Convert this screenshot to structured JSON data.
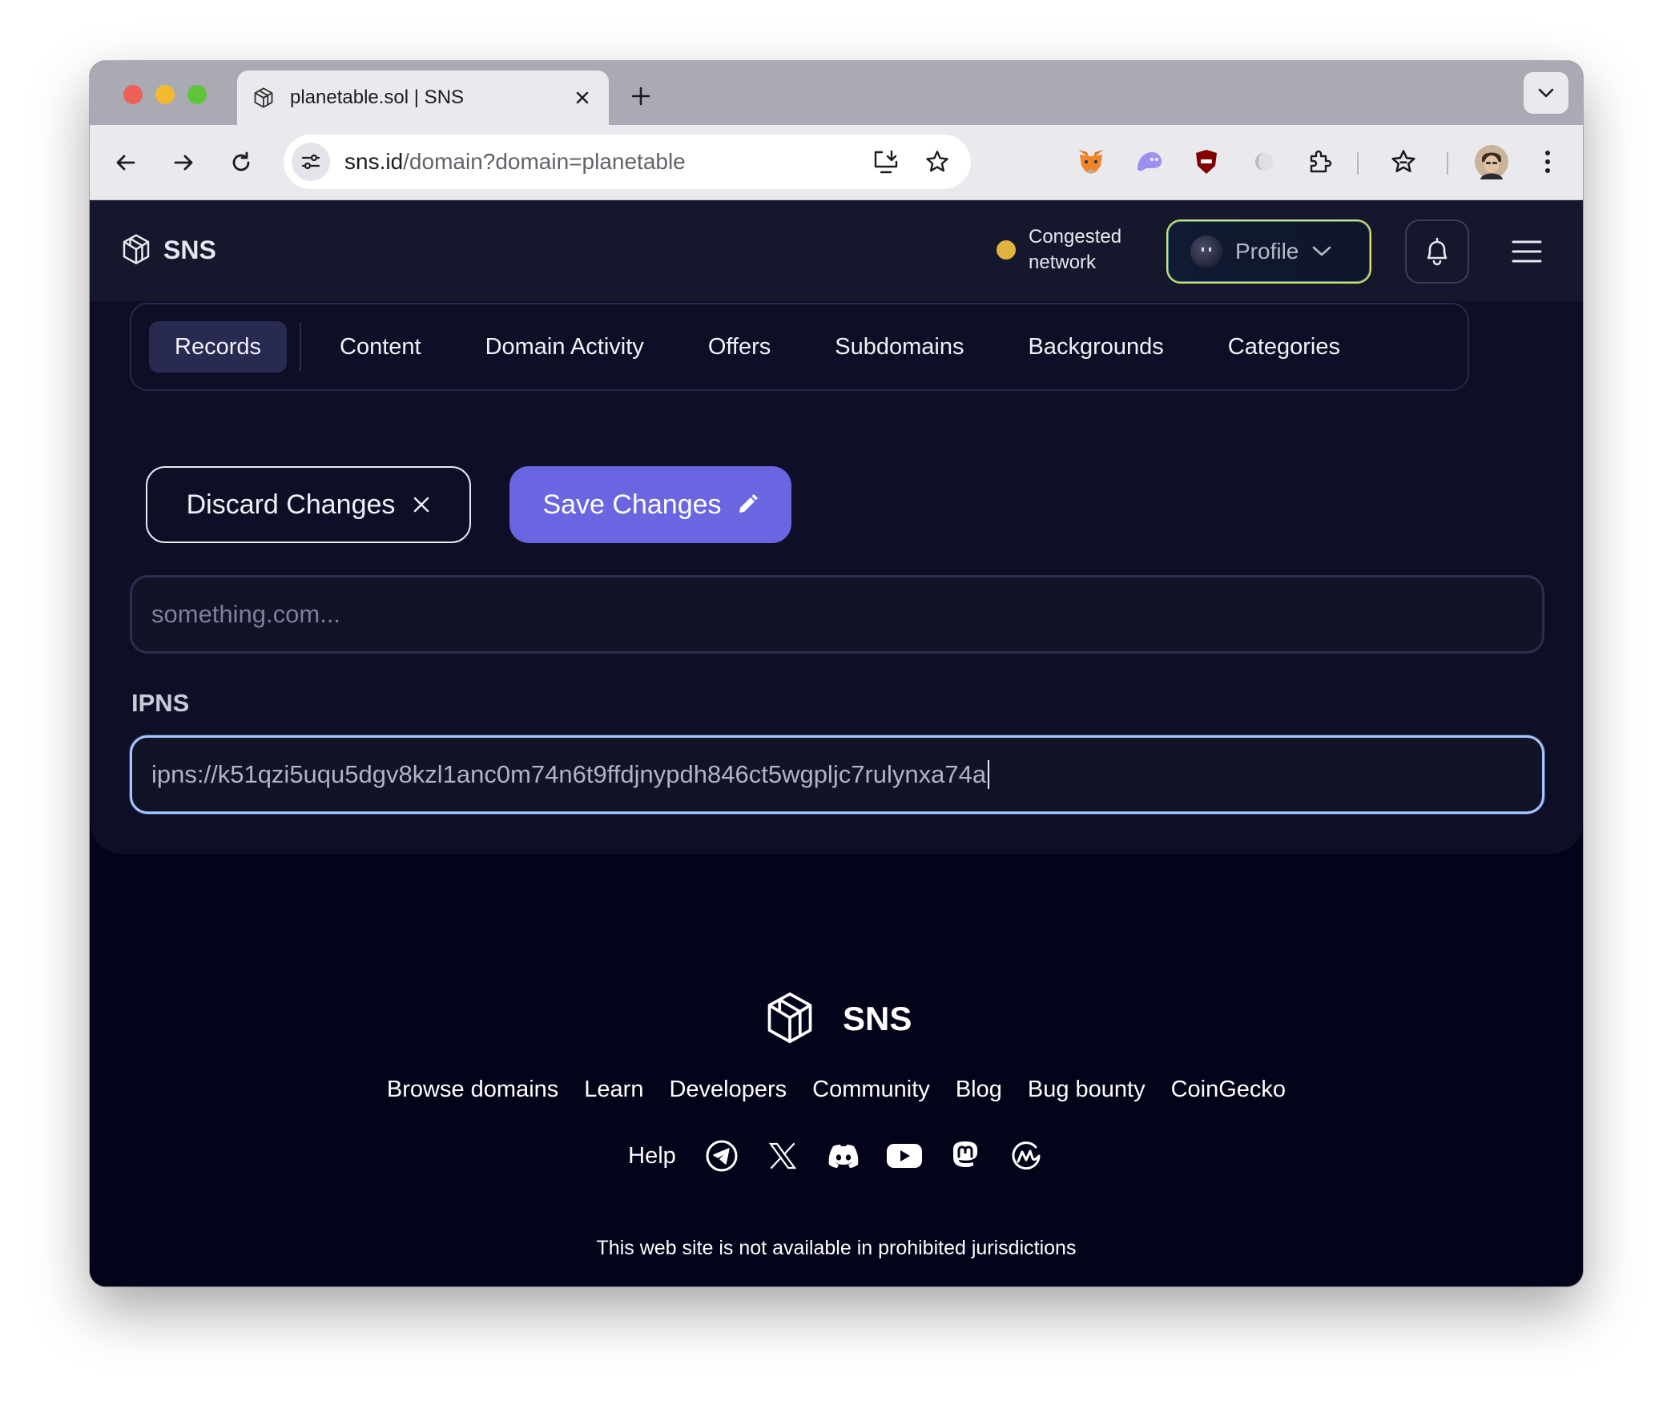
{
  "browser": {
    "tab_title": "planetable.sol | SNS",
    "url_host": "sns.id",
    "url_path": "/domain?domain=planetable"
  },
  "header": {
    "brand": "SNS",
    "status_text": "Congested network",
    "status_color": "#e1b33e",
    "profile_label": "Profile"
  },
  "tabs": [
    {
      "label": "Records",
      "active": true
    },
    {
      "label": "Content"
    },
    {
      "label": "Domain Activity"
    },
    {
      "label": "Offers"
    },
    {
      "label": "Subdomains"
    },
    {
      "label": "Backgrounds"
    },
    {
      "label": "Categories"
    }
  ],
  "actions": {
    "discard_label": "Discard Changes",
    "save_label": "Save Changes",
    "save_color": "#6a65e0"
  },
  "form": {
    "url_placeholder": "something.com...",
    "ipns_label": "IPNS",
    "ipns_value": "ipns://k51qzi5uqu5dgv8kzl1anc0m74n6t9ffdjnypdh846ct5wgpljc7rulynxa74a"
  },
  "footer": {
    "brand": "SNS",
    "links": [
      "Browse domains",
      "Learn",
      "Developers",
      "Community",
      "Blog",
      "Bug bounty",
      "CoinGecko"
    ],
    "help_label": "Help",
    "social_icons": [
      "telegram-icon",
      "x-icon",
      "discord-icon",
      "youtube-icon",
      "mastodon-icon",
      "coinmarketcap-icon"
    ],
    "disclaimer": "This web site is not available in prohibited jurisdictions"
  }
}
